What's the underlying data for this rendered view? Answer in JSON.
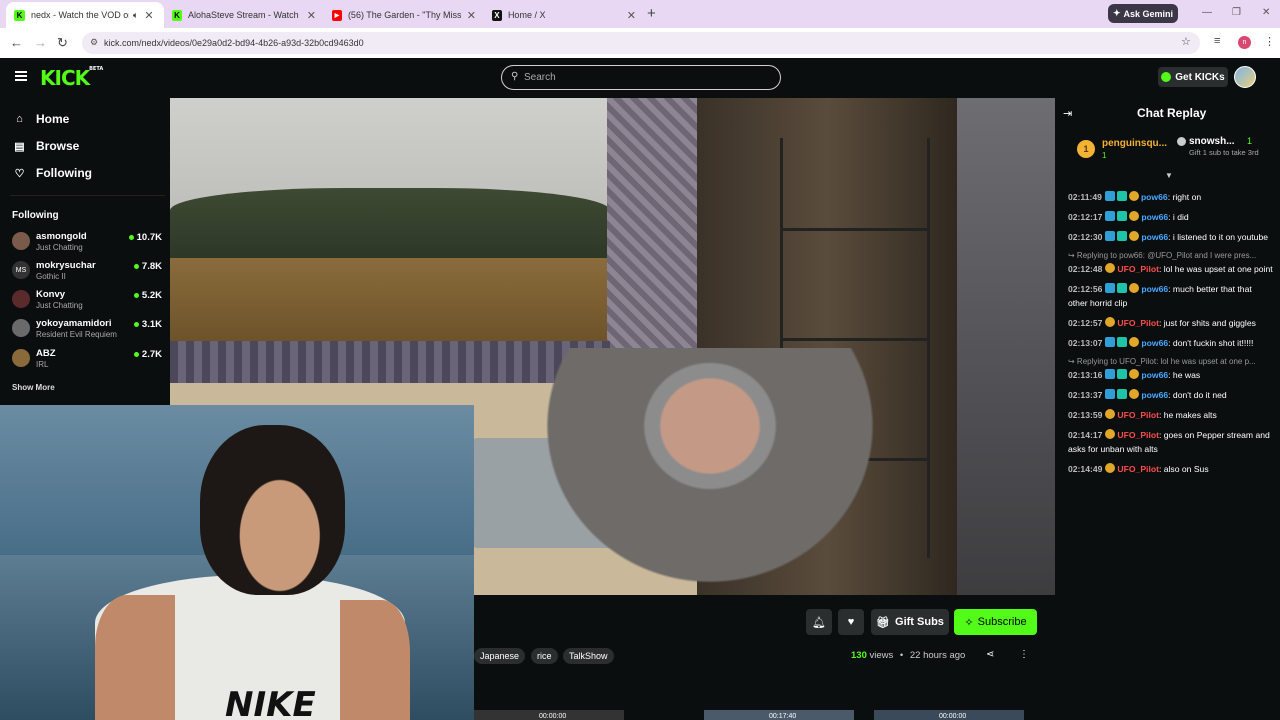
{
  "browser": {
    "tabs": [
      {
        "title": "nedx - Watch the VOD on K",
        "fav_color": "#53fc18",
        "fav_glyph": "K",
        "active": true
      },
      {
        "title": "AlohaSteve Stream - Watch Live",
        "fav_color": "#53fc18",
        "fav_glyph": "K"
      },
      {
        "title": "(56) The Garden - \"Thy Mission",
        "fav_color": "#ff0000",
        "fav_glyph": "▶"
      },
      {
        "title": "Home / X",
        "fav_color": "#111111",
        "fav_glyph": "X"
      }
    ],
    "ask_gemini": "Ask Gemini",
    "url": "kick.com/nedx/videos/0e29a0d2-bd94-4b26-a93d-32b0cd9463d0",
    "profile_initial": "n"
  },
  "header": {
    "logo": "KICK",
    "logo_tag": "BETA",
    "search_placeholder": "Search",
    "get_kicks": "Get KICKs"
  },
  "sidebar": {
    "nav": [
      {
        "label": "Home",
        "icon": "home-icon",
        "glyph": "⌂"
      },
      {
        "label": "Browse",
        "icon": "browse-icon",
        "glyph": "▤"
      },
      {
        "label": "Following",
        "icon": "heart-icon",
        "glyph": "♡"
      }
    ],
    "following_title": "Following",
    "following": [
      {
        "name": "asmongold",
        "category": "Just Chatting",
        "viewers": "10.7K",
        "avatar": "#7a5a4a"
      },
      {
        "name": "mokrysuchar",
        "category": "Gothic II",
        "viewers": "7.8K",
        "avatar": "#333333"
      },
      {
        "name": "Konvy",
        "category": "Just Chatting",
        "viewers": "5.2K",
        "avatar": "#5b2a2a"
      },
      {
        "name": "yokoyamamidori",
        "category": "Resident Evil Requiem",
        "viewers": "3.1K",
        "avatar": "#6a6a6a"
      },
      {
        "name": "ABZ",
        "category": "IRL",
        "viewers": "2.7K",
        "avatar": "#8a6a3a"
      }
    ],
    "show_more": "Show More"
  },
  "video": {
    "webcam_shirt_text": "NIKE"
  },
  "actions": {
    "gift_subs": "Gift Subs",
    "subscribe": "Subscribe"
  },
  "tags": [
    "Japanese",
    "rice",
    "TalkShow"
  ],
  "meta": {
    "views_count": "130",
    "views_label": "views",
    "separator": "•",
    "ago": "22 hours ago"
  },
  "thumbnails": [
    {
      "duration": "00:00:00"
    },
    {
      "duration": "00:17:40"
    },
    {
      "duration": "00:00:00"
    }
  ],
  "chat": {
    "title": "Chat Replay",
    "pinned": [
      {
        "rank": "1",
        "name": "penguinsqu...",
        "count": "1"
      },
      {
        "name": "snowsh...",
        "count": "1",
        "sub": "Gift 1 sub to take 3rd"
      }
    ],
    "messages": [
      {
        "time": "02:11:49",
        "user": "pow66",
        "color": "#4aa8ff",
        "badges": 3,
        "text": "right on"
      },
      {
        "time": "02:12:17",
        "user": "pow66",
        "color": "#4aa8ff",
        "badges": 3,
        "text": "i did"
      },
      {
        "time": "02:12:30",
        "user": "pow66",
        "color": "#4aa8ff",
        "badges": 3,
        "text": "i listened to it on youtube"
      },
      {
        "reply": "Replying to pow66: @UFO_Pilot and I were pres...",
        "time": "02:12:48",
        "user": "UFO_Pilot",
        "color": "#ff4d4d",
        "badges": 1,
        "text": "lol he was upset at one point"
      },
      {
        "time": "02:12:56",
        "user": "pow66",
        "color": "#4aa8ff",
        "badges": 3,
        "text": "much better that that other horrid clip"
      },
      {
        "time": "02:12:57",
        "user": "UFO_Pilot",
        "color": "#ff4d4d",
        "badges": 1,
        "text": "just for shits and giggles"
      },
      {
        "time": "02:13:07",
        "user": "pow66",
        "color": "#4aa8ff",
        "badges": 3,
        "text": "don't fuckin shot it!!!!!"
      },
      {
        "reply": "Replying to UFO_Pilot: lol he was upset at one p...",
        "time": "02:13:16",
        "user": "pow66",
        "color": "#4aa8ff",
        "badges": 3,
        "text": "he was"
      },
      {
        "time": "02:13:37",
        "user": "pow66",
        "color": "#4aa8ff",
        "badges": 3,
        "text": "don't do it ned"
      },
      {
        "time": "02:13:59",
        "user": "UFO_Pilot",
        "color": "#ff4d4d",
        "badges": 1,
        "text": "he makes alts"
      },
      {
        "time": "02:14:17",
        "user": "UFO_Pilot",
        "color": "#ff4d4d",
        "badges": 1,
        "text": "goes on Pepper stream and asks for unban with alts"
      },
      {
        "time": "02:14:49",
        "user": "UFO_Pilot",
        "color": "#ff4d4d",
        "badges": 1,
        "text": "also on Sus"
      }
    ]
  }
}
